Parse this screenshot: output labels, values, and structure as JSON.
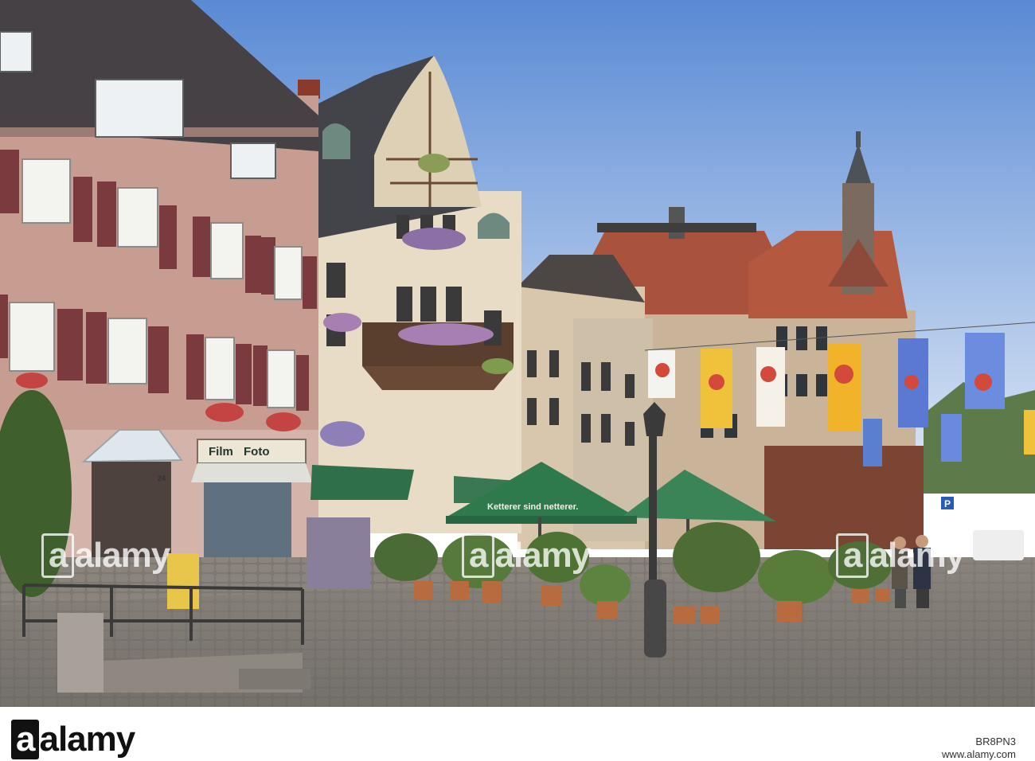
{
  "photo": {
    "scene": "town-square-street-photo"
  },
  "signs": {
    "shop_film": "Film",
    "shop_foto": "Foto",
    "umbrella_slogan": "Ketterer sind netterer.",
    "house_number": "24",
    "parking": "P"
  },
  "watermark": {
    "brand_word": "alamy",
    "brand_suffix": "a"
  },
  "footer": {
    "brand": "alamy",
    "stock_id": "BR8PN3",
    "site": "www.alamy.com"
  },
  "colors": {
    "sky_top": "#5f8fd6",
    "sky_bottom": "#c9daf2",
    "umbrella": "#2e7a4a",
    "shutter": "#7a3b3f",
    "facade_left": "#c99c93",
    "facade_mid": "#e6d7c0"
  }
}
